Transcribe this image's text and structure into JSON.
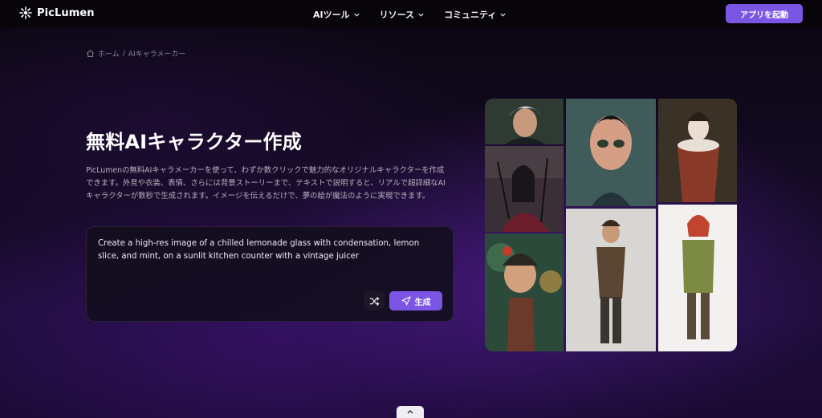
{
  "header": {
    "brand": "PicLumen",
    "nav": [
      {
        "label": "AIツール"
      },
      {
        "label": "リソース"
      },
      {
        "label": "コミュニティ"
      }
    ],
    "cta_label": "アプリを起動"
  },
  "breadcrumb": {
    "home": "ホーム",
    "separator": "/",
    "current": "AIキャラメーカー"
  },
  "hero": {
    "title": "無料AIキャラクター作成",
    "description": "PicLumenの無料AIキャラメーカーを使って、わずか数クリックで魅力的なオリジナルキャラクターを作成できます。外見や衣装、表情、さらには背景ストーリーまで、テキストで説明すると、リアルで超詳細なAIキャラクターが数秒で生成されます。イメージを伝えるだけで、夢の絵が魔法のように実現できます。"
  },
  "prompt": {
    "text": "Create a high-res image of a chilled lemonade glass with condensation, lemon slice, and mint, on a sunlit kitchen counter with a vintage juicer",
    "generate_label": "生成"
  },
  "icons": {
    "brand": "piclumen-logo-icon",
    "home": "home-icon",
    "shuffle": "shuffle-icon",
    "send": "send-icon",
    "chevron": "chevron-down-icon",
    "scroll": "chevron-up-icon"
  },
  "colors": {
    "accent": "#7b55e4",
    "header_bg": "#070509",
    "page_bg": "#1a0a33"
  }
}
